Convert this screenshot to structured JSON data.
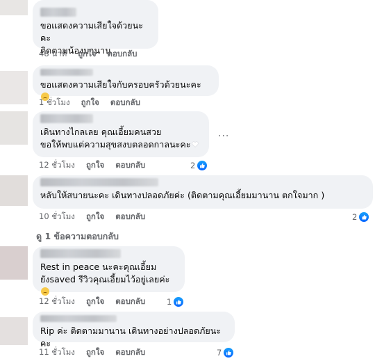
{
  "comments": [
    {
      "text": "ขอแสดงความเสียใจด้วยนะคะ\nติดตามน้องมานาน",
      "time": "48 นาที",
      "like": "ถูกใจ",
      "reply": "ตอบกลับ",
      "reactions": "",
      "emoji": ""
    },
    {
      "text": "ขอแสดงความเสียใจกับครอบครัวด้วยนะคะ ",
      "time": "1 ชั่วโมง",
      "like": "ถูกใจ",
      "reply": "ตอบกลับ",
      "reactions": "",
      "emoji": "sad"
    },
    {
      "text": "เดินทางไกลเลย คุณเอี้ยมคนสวย\nขอให้พบแต่ความสุขสงบตลอดกาลนะคะ",
      "time": "12 ชั่วโมง",
      "like": "ถูกใจ",
      "reply": "ตอบกลับ",
      "reactions": "2",
      "emoji": "heart",
      "more": "..."
    },
    {
      "text": "หลับให้สบายนะคะ เดินทางปลอดภัยค่ะ       (ติดตามคุณเอี้ยมมานาน ตกใจมาก )",
      "time": "10 ชั่วโมง",
      "like": "ถูกใจ",
      "reply": "ตอบกลับ",
      "reactions": "2",
      "emoji": ""
    },
    {
      "text": "Rest in peace       นะคะคุณเอี้ยม\nยังsaved รีวิวคุณเอี้ยมไว้อยู่เลยค่ะ",
      "time": "12 ชั่วโมง",
      "like": "ถูกใจ",
      "reply": "ตอบกลับ",
      "reactions": "1",
      "emoji": "sad"
    },
    {
      "text": "Rip ค่ะ ติดตามมานาน เดินทางอย่างปลอดภัยนะคะ",
      "time": "11 ชั่วโมง",
      "like": "ถูกใจ",
      "reply": "ตอบกลับ",
      "reactions": "7",
      "emoji": ""
    }
  ],
  "view_replies": "ดู 1 ข้อความตอบกลับ",
  "colors": {
    "bubble": "#f0f2f5",
    "meta": "#65676b",
    "like": "#0866ff"
  }
}
